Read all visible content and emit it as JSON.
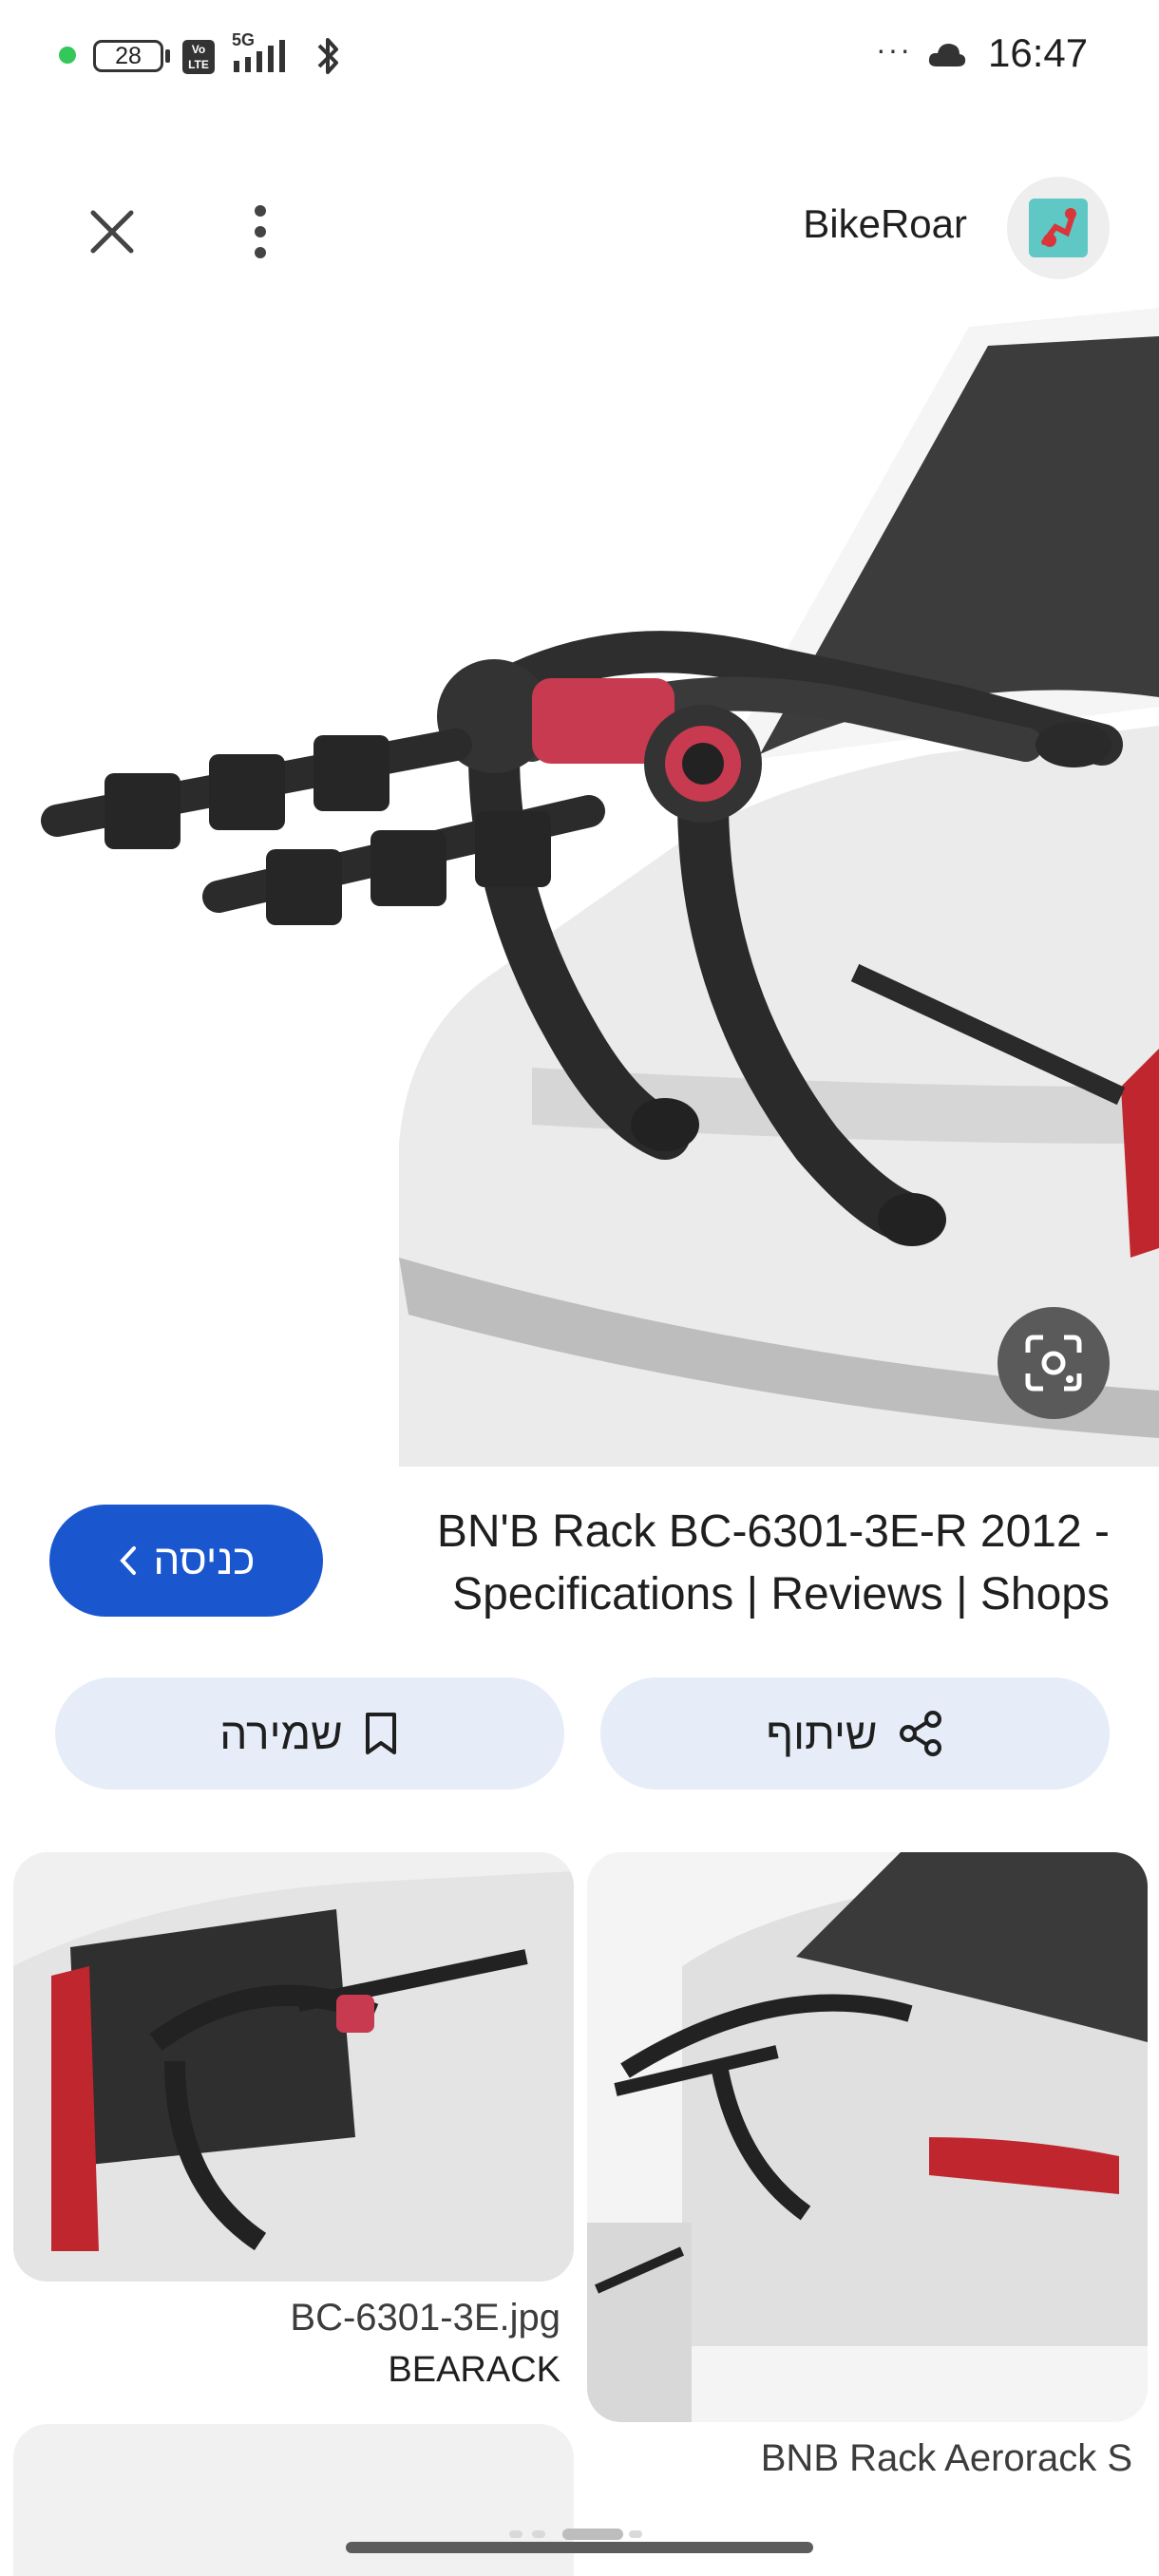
{
  "status_bar": {
    "battery": "28",
    "network_badge": "Vo LTE",
    "network_type": "5G",
    "more": "···",
    "time": "16:47"
  },
  "header": {
    "site_name": "BikeRoar",
    "close_icon": "close-icon",
    "menu_icon": "more-vert-icon"
  },
  "main": {
    "title": "BN'B Rack BC-6301-3E-R 2012 - Specifications | Reviews | Shops",
    "visit_label": "כניסה",
    "visit_icon": "chevron-left-icon",
    "lens_icon": "google-lens-icon"
  },
  "actions": {
    "save_label": "שמירה",
    "share_label": "שיתוף"
  },
  "related": [
    {
      "caption": "BC-6301-3E.jpg",
      "source": "BEARACK"
    },
    {
      "caption": "BNB Rack Aerorack S"
    }
  ],
  "colors": {
    "visit_button": "#1a57cf",
    "action_button": "#e6edf9",
    "rack_accent": "#c83a4f"
  }
}
